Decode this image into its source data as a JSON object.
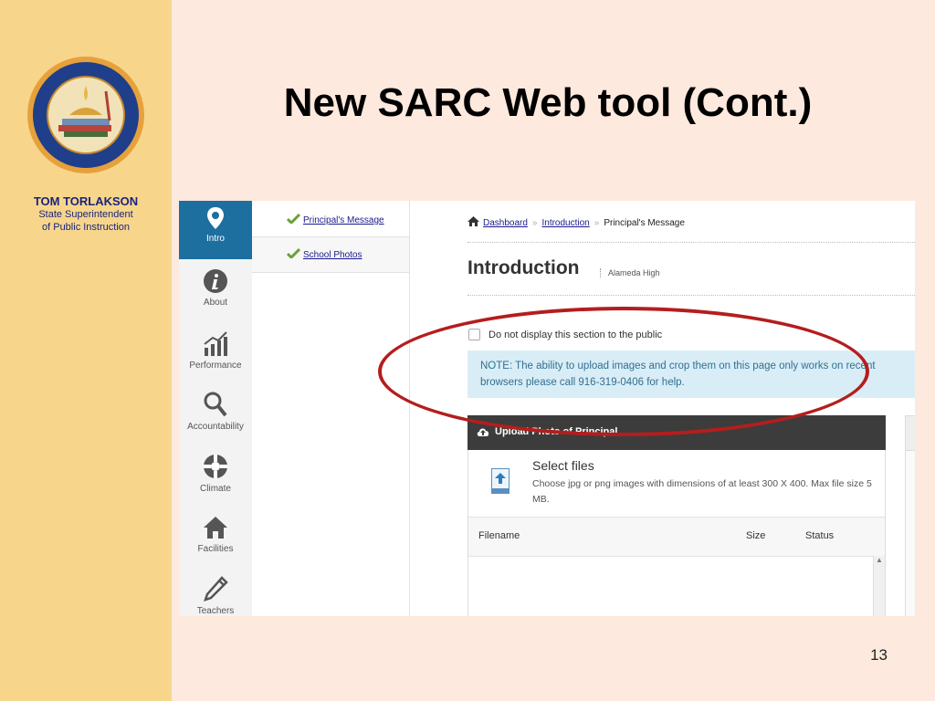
{
  "slide": {
    "title": "New SARC Web tool (Cont.)",
    "author_name": "TOM TORLAKSON",
    "author_role_line1": "State Superintendent",
    "author_role_line2": "of Public Instruction",
    "page_number": "13",
    "seal_text": "DEPARTMENT OF EDUCATION • STATE OF CALIFORNIA"
  },
  "iconbar": {
    "items": [
      {
        "label": "Intro",
        "icon": "map-pin-icon",
        "active": true
      },
      {
        "label": "About",
        "icon": "info-icon"
      },
      {
        "label": "Performance",
        "icon": "chart-icon"
      },
      {
        "label": "Accountability",
        "icon": "search-icon"
      },
      {
        "label": "Climate",
        "icon": "lifebuoy-icon"
      },
      {
        "label": "Facilities",
        "icon": "home-icon"
      },
      {
        "label": "Teachers",
        "icon": "pencil-icon"
      }
    ]
  },
  "subnav": {
    "items": [
      {
        "label": "Principal's Message",
        "icon": "check-icon"
      },
      {
        "label": "School Photos",
        "icon": "check-icon"
      }
    ]
  },
  "breadcrumb": {
    "home": "Dashboard",
    "mid": "Introduction",
    "current": "Principal's Message",
    "sep": "»"
  },
  "main": {
    "heading": "Introduction",
    "school": "Alameda High",
    "checkbox_label": "Do not display this section to the public",
    "note": "NOTE: The ability to upload images and crop them on this page only works on recent browsers please call 916-319-0406 for help.",
    "upload_header": "Upload Photo of Principal",
    "select_title": "Select files",
    "select_desc": "Choose jpg or png images with dimensions of at least 300 X 400. Max file size 5 MB.",
    "table_headers": [
      "Filename",
      "Size",
      "Status"
    ],
    "scroll_up": "▲"
  },
  "colors": {
    "accent": "#1d6f9f",
    "highlight_ellipse": "#b51d1d",
    "note_bg": "#d9edf7",
    "left_band": "#f7d68c",
    "slide_bg": "#fde9dd"
  }
}
